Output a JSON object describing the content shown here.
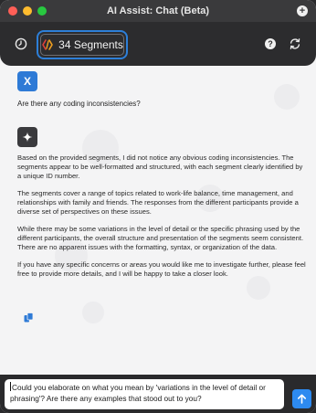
{
  "window": {
    "title": "AI Assist: Chat (Beta)"
  },
  "toolbar": {
    "segments_label": "34 Segments",
    "help_glyph": "?"
  },
  "chat": {
    "user_avatar_letter": "X",
    "user_message": "Are there any coding inconsistencies?",
    "ai_paragraphs": [
      "Based on the provided segments, I did not notice any obvious coding inconsistencies. The segments appear to be well-formatted and structured, with each segment clearly identified by a unique ID number.",
      "The segments cover a range of topics related to work-life balance, time management, and relationships with family and friends. The responses from the different participants provide a diverse set of perspectives on these issues.",
      "While there may be some variations in the level of detail or the specific phrasing used by the different participants, the overall structure and presentation of the segments seem consistent. There are no apparent issues with the formatting, syntax, or organization of the data.",
      "If you have any specific concerns or areas you would like me to investigate further, please feel free to provide more details, and I will be happy to take a closer look."
    ]
  },
  "input": {
    "value": "Could you elaborate on what you mean by 'variations in the level of detail or phrasing'? Are there any examples that stood out to you?"
  },
  "icons": {
    "history": "history-icon",
    "segments": "segments-icon",
    "help": "help-icon",
    "refresh": "refresh-icon",
    "ai_avatar": "sparkle-icon",
    "copy": "copy-icon",
    "send": "arrow-up-icon",
    "new_chat": "plus-icon"
  },
  "colors": {
    "accent": "#2d7fd8",
    "user_avatar": "#2e7ad6",
    "send_button": "#2d8af0",
    "segments_icon": "#f0a020"
  }
}
